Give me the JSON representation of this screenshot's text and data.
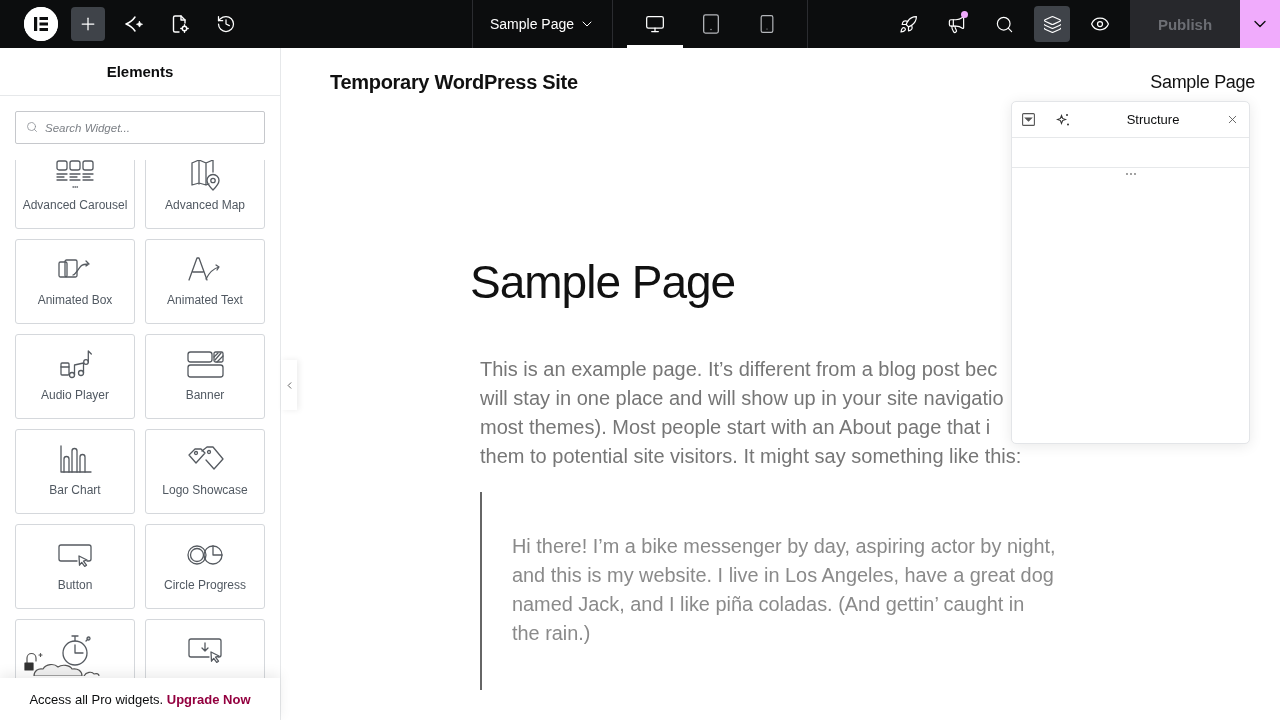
{
  "top_bar": {
    "left_tools": [
      {
        "selected": true
      },
      {
        "selected": false
      },
      {
        "selected": false
      },
      {
        "selected": false
      }
    ],
    "page_title": "Sample Page",
    "devices": [
      {
        "selected": true
      },
      {
        "selected": false
      },
      {
        "selected": false
      }
    ],
    "right_tools": [
      {
        "selected": false,
        "notification": false
      },
      {
        "selected": false,
        "notification": true
      },
      {
        "selected": false,
        "notification": false
      },
      {
        "selected": true,
        "notification": false
      },
      {
        "selected": false,
        "notification": false
      }
    ],
    "publish": {
      "label": "Publish",
      "disabled": true
    }
  },
  "sidebar": {
    "title": "Elements",
    "search": {
      "placeholder": "Search Widget..."
    },
    "widgets": [
      {
        "label": "Advanced Carousel"
      },
      {
        "label": "Advanced Map"
      },
      {
        "label": "Animated Box"
      },
      {
        "label": "Animated Text"
      },
      {
        "label": "Audio Player"
      },
      {
        "label": "Banner"
      },
      {
        "label": "Bar Chart"
      },
      {
        "label": "Logo Showcase"
      },
      {
        "label": "Button"
      },
      {
        "label": "Circle Progress"
      }
    ],
    "promo": {
      "text": "Access all Pro widgets.",
      "link": "Upgrade Now"
    }
  },
  "canvas": {
    "site_title": "Temporary WordPress Site",
    "nav": [
      {
        "label": "Sample Page"
      }
    ],
    "page_title": "Sample Page",
    "paragraph": {
      "lines": [
        "This is an example page. It’s different from a blog post bec",
        "will stay in one place and will show up in your site navigatio",
        "most themes). Most people start with an About page that i",
        "them to potential site visitors. It might say something like this:"
      ]
    },
    "quote": {
      "lines": [
        "Hi there! I’m a bike messenger by day, aspiring actor by night,",
        "and this is my website. I live in Los Angeles, have a great dog",
        "named Jack, and I like piña coladas. (And gettin’ caught in",
        "the rain.)"
      ]
    }
  },
  "structure_panel": {
    "title": "Structure"
  }
}
